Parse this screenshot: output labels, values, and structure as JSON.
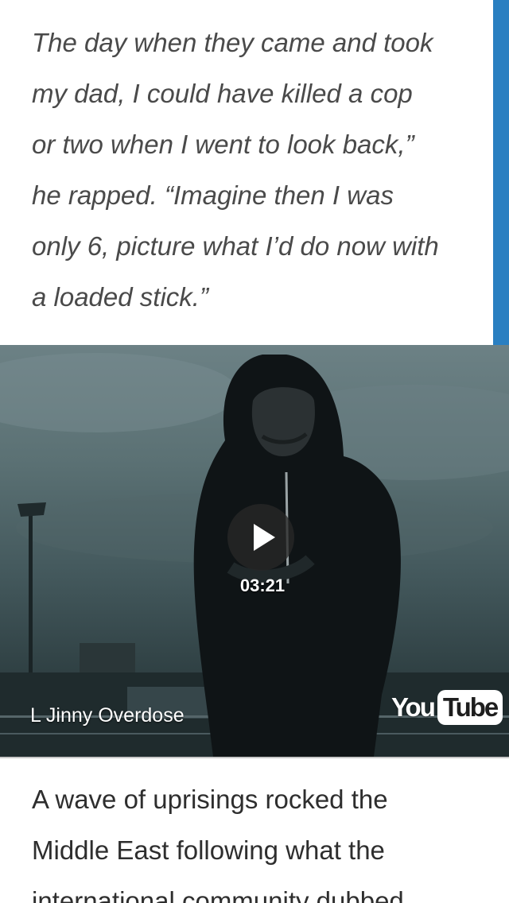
{
  "quote": {
    "lines": [
      "The day when they came and took",
      "my dad, I could have killed a cop",
      "or two when I went to look back,”",
      "he rapped. “Imagine then I was",
      "only 6, picture what I’d do now with",
      "a loaded stick.”"
    ]
  },
  "video": {
    "duration": "03:21",
    "title": "L Jinny Overdose",
    "logo_you": "You",
    "logo_tube": "Tube",
    "play_icon": "play-icon"
  },
  "article": {
    "lines": [
      "A wave of uprisings rocked the",
      "Middle East following what the",
      "international community dubbed"
    ]
  },
  "colors": {
    "accent": "#2a7fc1",
    "quote_text": "#4a4a4a",
    "body_text": "#2e2e2e"
  }
}
